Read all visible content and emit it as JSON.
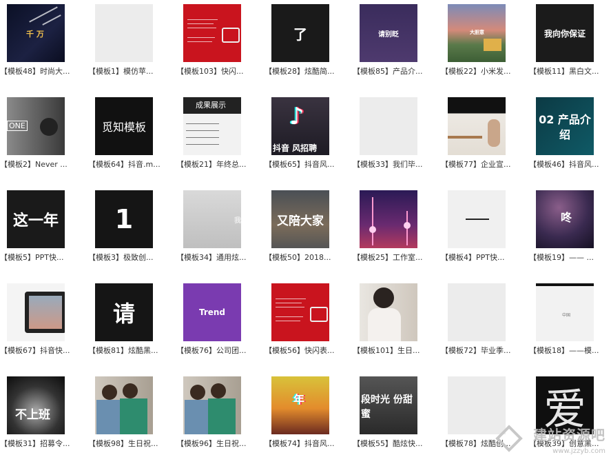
{
  "gallery": {
    "items": [
      {
        "caption": "【模板48】时尚大...",
        "thumb_text": "千 万"
      },
      {
        "caption": "【模板1】模仿苹...",
        "thumb_text": ""
      },
      {
        "caption": "【模板103】快闪...",
        "thumb_text": ""
      },
      {
        "caption": "【模板28】炫酷简...",
        "thumb_text": "了"
      },
      {
        "caption": "【模板85】产品介...",
        "thumb_text": "请别眨"
      },
      {
        "caption": "【模板22】小米发...",
        "thumb_text": "大胆意"
      },
      {
        "caption": "【模板11】黑白文...",
        "thumb_text": "我向你保证"
      },
      {
        "caption": "【模板2】Never ...",
        "thumb_text": "ONE"
      },
      {
        "caption": "【模板64】抖音.m...",
        "thumb_text": "觅知模板"
      },
      {
        "caption": "【模板21】年终总...",
        "thumb_text": "成果展示"
      },
      {
        "caption": "【模板65】抖音风...",
        "thumb_text": "抖音 风招聘"
      },
      {
        "caption": "【模板33】我们毕...",
        "thumb_text": ""
      },
      {
        "caption": "【模板77】企业宣...",
        "thumb_text": ""
      },
      {
        "caption": "【模板46】抖音风...",
        "thumb_text": "02 产品介绍"
      },
      {
        "caption": "【模板5】PPT快...",
        "thumb_text": "这一年"
      },
      {
        "caption": "【模板3】极致创...",
        "thumb_text": "1"
      },
      {
        "caption": "【模板34】通用炫...",
        "thumb_text": "我"
      },
      {
        "caption": "【模板50】2018...",
        "thumb_text": "又陪大家"
      },
      {
        "caption": "【模板25】工作室...",
        "thumb_text": ""
      },
      {
        "caption": "【模板4】PPT快...",
        "thumb_text": ""
      },
      {
        "caption": "【模板19】—— ...",
        "thumb_text": "咚"
      },
      {
        "caption": "【模板67】抖音快...",
        "thumb_text": ""
      },
      {
        "caption": "【模板81】炫酷黑...",
        "thumb_text": "请"
      },
      {
        "caption": "【模板76】公司团...",
        "thumb_text": "Trend"
      },
      {
        "caption": "【模板56】快闪表...",
        "thumb_text": ""
      },
      {
        "caption": "【模板101】生日...",
        "thumb_text": ""
      },
      {
        "caption": "【模板72】毕业季...",
        "thumb_text": ""
      },
      {
        "caption": "【模板18】——模...",
        "thumb_text": "中国"
      },
      {
        "caption": "【模板31】招募令...",
        "thumb_text": "不上班"
      },
      {
        "caption": "【模板98】生日祝...",
        "thumb_text": ""
      },
      {
        "caption": "【模板96】生日祝...",
        "thumb_text": ""
      },
      {
        "caption": "【模板74】抖音风...",
        "thumb_text": "年"
      },
      {
        "caption": "【模板55】酷炫快...",
        "thumb_text": "段时光 份甜蜜"
      },
      {
        "caption": "【模板78】炫酷创...",
        "thumb_text": ""
      },
      {
        "caption": "【模板39】创意黑...",
        "thumb_text": "爱"
      }
    ]
  },
  "watermark": {
    "text": "建站资源吧",
    "url": "www.jzzyb.com"
  }
}
